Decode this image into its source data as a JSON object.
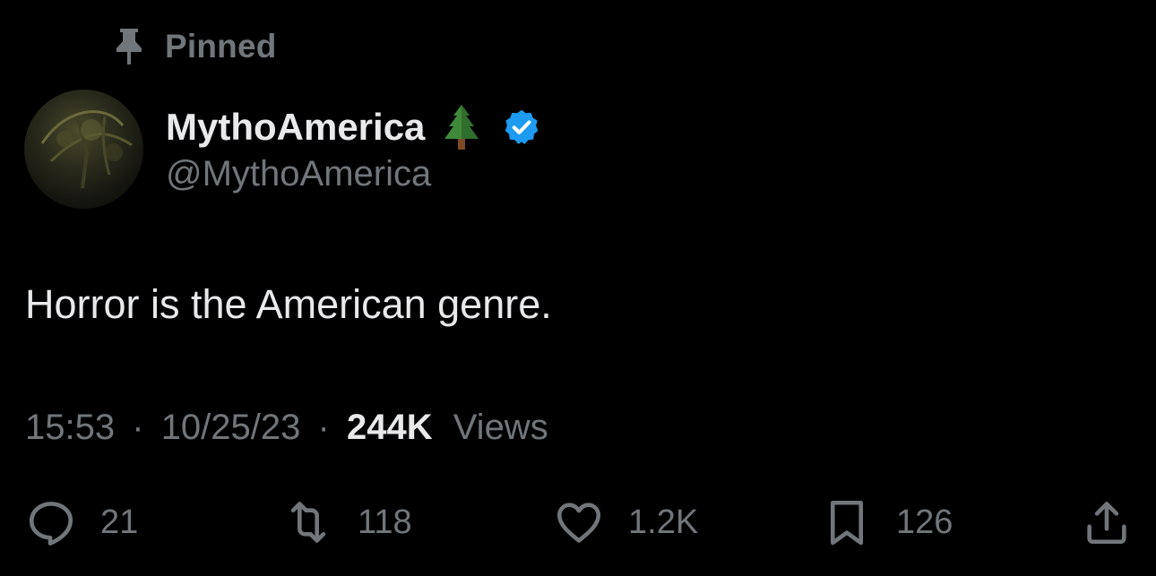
{
  "pinned": {
    "label": "Pinned",
    "icon": "pin-icon"
  },
  "author": {
    "display_name": "MythoAmerica",
    "name_emoji_icon": "evergreen-tree-icon",
    "verified_icon": "verified-badge-icon",
    "handle": "@MythoAmerica"
  },
  "tweet": {
    "text": "Horror is the American genre.",
    "time": "15:53",
    "separator": "·",
    "date": "10/25/23",
    "views_count": "244K",
    "views_label": "Views"
  },
  "actions": {
    "reply": {
      "icon": "reply-icon",
      "count": "21"
    },
    "retweet": {
      "icon": "retweet-icon",
      "count": "118"
    },
    "like": {
      "icon": "heart-icon",
      "count": "1.2K"
    },
    "bookmark": {
      "icon": "bookmark-icon",
      "count": "126"
    },
    "share": {
      "icon": "share-icon"
    }
  },
  "colors": {
    "background": "#000000",
    "primary_text": "#e7e9ea",
    "secondary_text": "#71767b",
    "verified_blue": "#1d9bf0"
  }
}
